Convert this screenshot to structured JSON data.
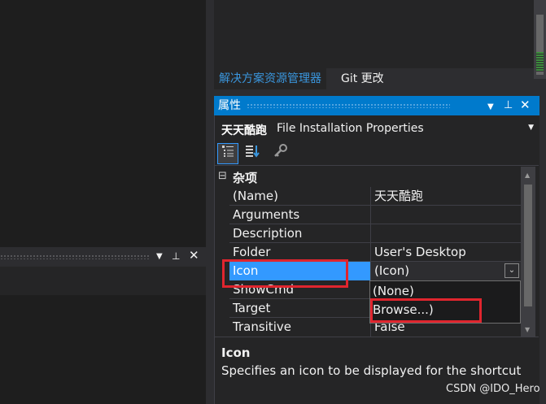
{
  "solution_explorer": {
    "tabs": [
      {
        "label": "解决方案资源管理器"
      },
      {
        "label": "Git 更改"
      }
    ]
  },
  "properties": {
    "title": "属性",
    "object_name": "天天酷跑",
    "object_type": "File Installation Properties",
    "toolbar": [
      "categorized-icon",
      "alphabetical-icon",
      "property-pages-icon"
    ],
    "category": {
      "expander": "⊟",
      "label": "杂项"
    },
    "rows": [
      {
        "name": "(Name)",
        "value": "天天酷跑"
      },
      {
        "name": "Arguments",
        "value": ""
      },
      {
        "name": "Description",
        "value": ""
      },
      {
        "name": "Folder",
        "value": "User's Desktop"
      },
      {
        "name": "Icon",
        "value": "(Icon)",
        "selected": true
      },
      {
        "name": "ShowCmd",
        "value": ""
      },
      {
        "name": "Target",
        "value": ""
      },
      {
        "name": "Transitive",
        "value": "False"
      }
    ],
    "dropdown_options": [
      "(None)",
      "Browse...)"
    ],
    "description": {
      "title": "Icon",
      "text": "Specifies an icon to be displayed for the shortcut"
    }
  },
  "watermark": "CSDN @IDO_Hero",
  "colors": {
    "accent": "#007acc",
    "selection": "#3399ff",
    "highlight_box": "#e0252e",
    "background": "#2d2d30"
  }
}
